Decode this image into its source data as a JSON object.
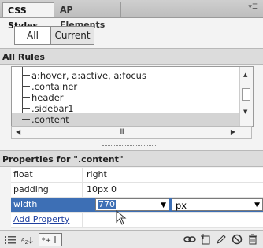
{
  "tabs": [
    "CSS Styles",
    "AP Elements"
  ],
  "toggle": {
    "all": "All",
    "current": "Current"
  },
  "rules_header": "All Rules",
  "rules": [
    {
      "label": "a:hover, a:active, a:focus",
      "selected": false
    },
    {
      "label": ".container",
      "selected": false
    },
    {
      "label": "header",
      "selected": false
    },
    {
      "label": ".sidebar1",
      "selected": false
    },
    {
      "label": ".content",
      "selected": true
    }
  ],
  "hscroll_grip": "III",
  "props_header": "Properties for \".content\"",
  "properties": [
    {
      "name": "float",
      "value": "right"
    },
    {
      "name": "padding",
      "value": "10px 0"
    },
    {
      "name": "width",
      "value": "770",
      "unit": "px",
      "editing": true
    }
  ],
  "add_property": "Add Property",
  "toolbar_icons": {
    "left": [
      "category-view-icon",
      "alpha-sort-icon",
      "set-properties-icon"
    ],
    "right": [
      "attach-stylesheet-icon",
      "new-rule-icon",
      "edit-rule-icon",
      "disable-property-icon",
      "delete-rule-icon"
    ]
  },
  "colors": {
    "selection": "#3d6fb5",
    "link": "#1f3f9f"
  }
}
